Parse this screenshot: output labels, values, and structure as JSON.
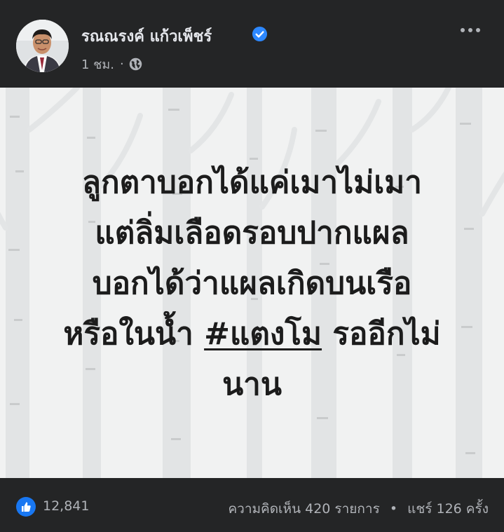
{
  "post": {
    "author_name": "รณณรงค์ แก้วเพ็ชร์",
    "timestamp": "1 ชม.",
    "meta_separator": "·",
    "privacy_icon": "globe-icon",
    "verified_icon": "verified-badge-icon",
    "more_icon": "more-horizontal-icon"
  },
  "image_text": {
    "line1": "ลูกตาบอกได้แค่เมาไม่เมา",
    "line2": "แต่ลิ่มเลือดรอบปากแผล",
    "line3": "บอกได้ว่าแผลเกิดบนเรือ",
    "line4_before": "หรือในน้ำ ",
    "line4_hashtag": "#แตงโม",
    "line4_after": " รออีกไม่",
    "line5": "นาน"
  },
  "footer": {
    "reaction_icon": "like-icon",
    "reaction_count": "12,841",
    "comments": "ความคิดเห็น 420 รายการ",
    "separator": "•",
    "shares": "แชร์ 126 ครั้ง"
  },
  "colors": {
    "background": "#242526",
    "text_primary": "#e4e6eb",
    "text_secondary": "#b0b3b8",
    "verified_blue": "#2d88ff",
    "like_blue": "#1877f2",
    "image_bg": "#f0f1f1"
  }
}
